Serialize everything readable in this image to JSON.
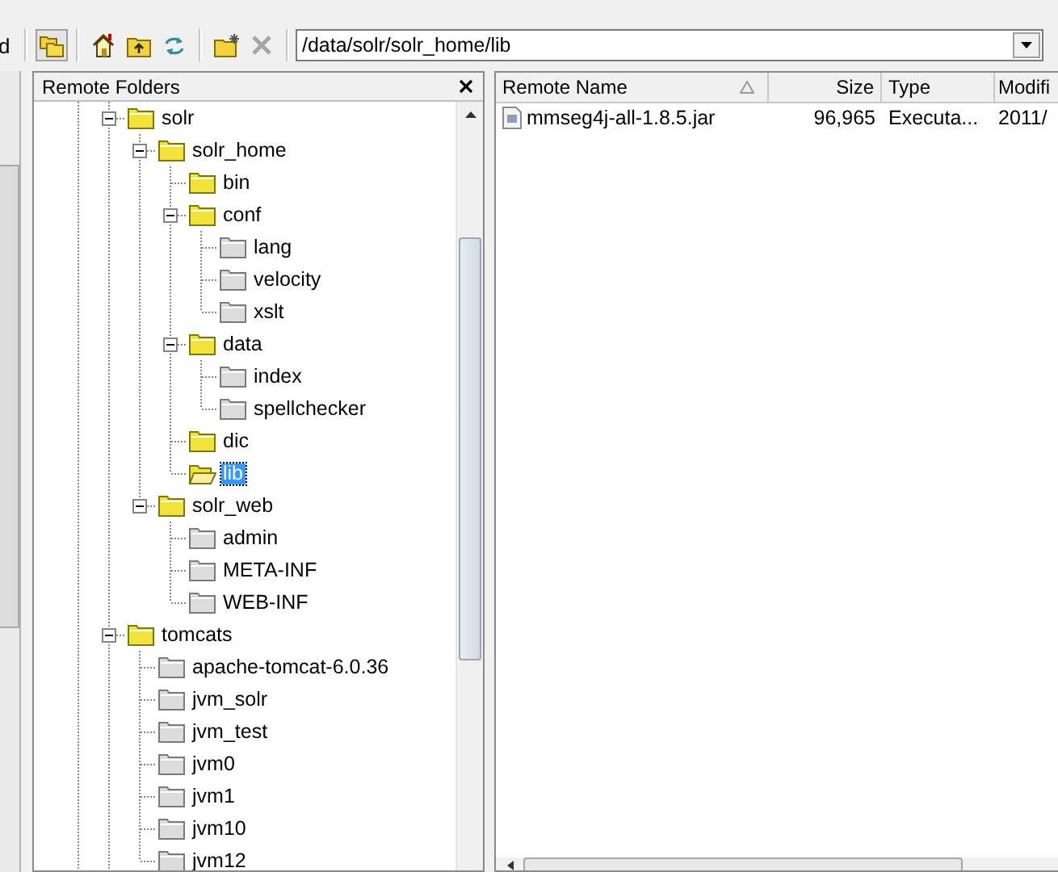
{
  "toolbar": {
    "cut_label": "d",
    "groups": [
      [
        {
          "kind": "folders",
          "pressed": true,
          "disabled": false
        }
      ],
      [
        {
          "kind": "home",
          "pressed": false,
          "disabled": false
        },
        {
          "kind": "parent",
          "pressed": false,
          "disabled": false
        },
        {
          "kind": "refresh",
          "pressed": false,
          "disabled": false
        }
      ],
      [
        {
          "kind": "newfolder",
          "pressed": false,
          "disabled": false
        },
        {
          "kind": "delete",
          "pressed": false,
          "disabled": true
        }
      ]
    ]
  },
  "address": {
    "value": "/data/solr/solr_home/lib"
  },
  "folder_panel": {
    "title": "Remote Folders",
    "tree": [
      {
        "label": "solr",
        "kind": "yellow",
        "expanded": true,
        "selected": false,
        "children": [
          {
            "label": "solr_home",
            "kind": "yellow",
            "expanded": true,
            "selected": false,
            "children": [
              {
                "label": "bin",
                "kind": "yellow",
                "selected": false
              },
              {
                "label": "conf",
                "kind": "yellow",
                "expanded": true,
                "selected": false,
                "children": [
                  {
                    "label": "lang",
                    "kind": "grey",
                    "selected": false
                  },
                  {
                    "label": "velocity",
                    "kind": "grey",
                    "selected": false
                  },
                  {
                    "label": "xslt",
                    "kind": "grey",
                    "selected": false
                  }
                ]
              },
              {
                "label": "data",
                "kind": "yellow",
                "expanded": true,
                "selected": false,
                "children": [
                  {
                    "label": "index",
                    "kind": "grey",
                    "selected": false
                  },
                  {
                    "label": "spellchecker",
                    "kind": "grey",
                    "selected": false
                  }
                ]
              },
              {
                "label": "dic",
                "kind": "yellow",
                "selected": false
              },
              {
                "label": "lib",
                "kind": "open",
                "selected": true
              }
            ]
          },
          {
            "label": "solr_web",
            "kind": "yellow",
            "expanded": true,
            "selected": false,
            "children": [
              {
                "label": "admin",
                "kind": "grey",
                "selected": false
              },
              {
                "label": "META-INF",
                "kind": "grey",
                "selected": false
              },
              {
                "label": "WEB-INF",
                "kind": "grey",
                "selected": false
              }
            ]
          }
        ]
      },
      {
        "label": "tomcats",
        "kind": "yellow",
        "expanded": true,
        "selected": false,
        "children": [
          {
            "label": "apache-tomcat-6.0.36",
            "kind": "grey",
            "selected": false
          },
          {
            "label": "jvm_solr",
            "kind": "grey",
            "selected": false
          },
          {
            "label": "jvm_test",
            "kind": "grey",
            "selected": false
          },
          {
            "label": "jvm0",
            "kind": "grey",
            "selected": false
          },
          {
            "label": "jvm1",
            "kind": "grey",
            "selected": false
          },
          {
            "label": "jvm10",
            "kind": "grey",
            "selected": false
          },
          {
            "label": "jvm12",
            "kind": "grey",
            "selected": false
          }
        ]
      }
    ]
  },
  "file_list": {
    "columns": [
      {
        "label": "Remote Name",
        "sorted": true
      },
      {
        "label": "Size",
        "sorted": false
      },
      {
        "label": "Type",
        "sorted": false
      },
      {
        "label": "Modifi",
        "sorted": false
      }
    ],
    "rows": [
      {
        "cells": [
          "mmseg4j-all-1.8.5.jar",
          "96,965",
          "Executa...",
          "2011/"
        ],
        "selected": false
      }
    ]
  }
}
